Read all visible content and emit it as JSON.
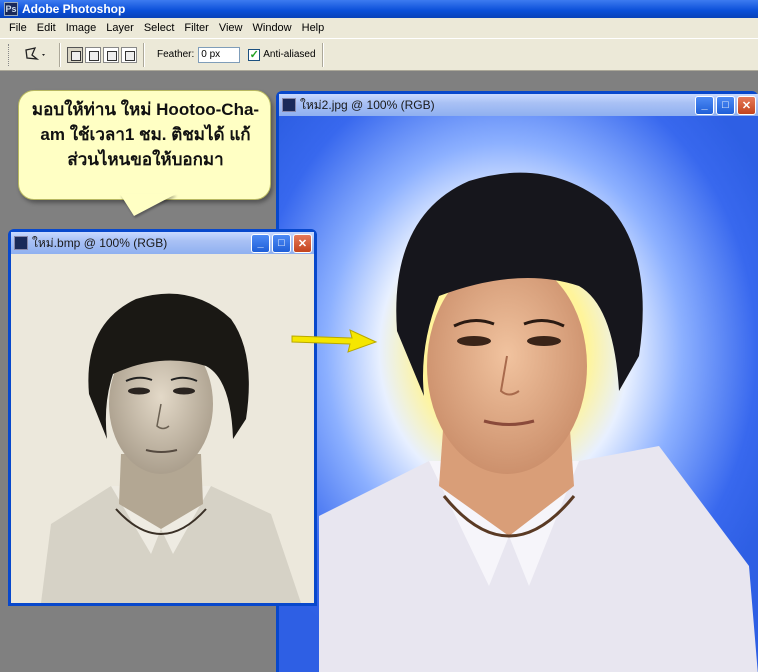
{
  "app": {
    "title": "Adobe Photoshop"
  },
  "menu": [
    "File",
    "Edit",
    "Image",
    "Layer",
    "Select",
    "Filter",
    "View",
    "Window",
    "Help"
  ],
  "options": {
    "tool_icon": "polygonal-lasso-icon",
    "feather_label": "Feather:",
    "feather_value": "0 px",
    "antialias_label": "Anti-aliased",
    "antialias_checked": true
  },
  "callout": {
    "text": "มอบให้ท่าน ใหม่ Hootoo-Cha-am ใช้เวลา1 ชม. ติชมได้ แก้ส่วนไหนขอให้บอกมา"
  },
  "windows": {
    "original": {
      "title": "ใหม่.bmp @ 100% (RGB)"
    },
    "edited": {
      "title": "ใหม่2.jpg @ 100% (RGB)"
    }
  },
  "colors": {
    "titlebar": "#0a4fd8",
    "canvas_bg": "#2e62e6",
    "glow": "#fff7a0",
    "arrow": "#f5e600"
  }
}
